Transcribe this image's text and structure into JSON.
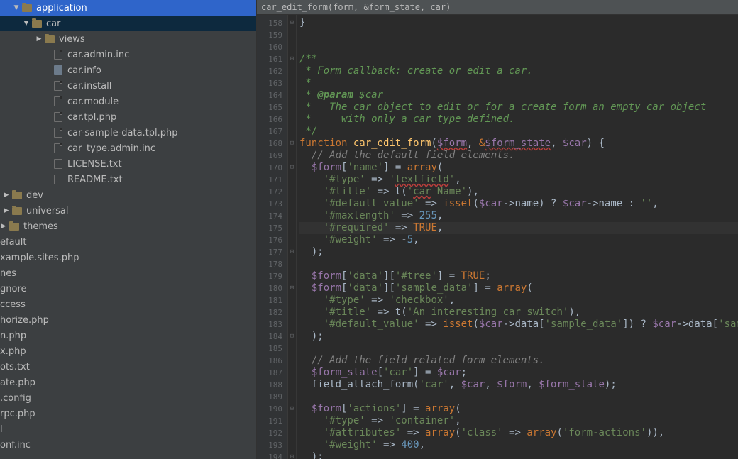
{
  "breadcrumb": "car_edit_form(form, &form_state, car)",
  "sidebar": {
    "items": [
      {
        "label": "application",
        "indent": 18,
        "arrow": "▼",
        "icon": "folder",
        "topsel": true
      },
      {
        "label": "car",
        "indent": 32,
        "arrow": "▼",
        "icon": "folder",
        "sel": true
      },
      {
        "label": "views",
        "indent": 50,
        "arrow": "▶",
        "icon": "folder"
      },
      {
        "label": "car.admin.inc",
        "indent": 62,
        "icon": "php"
      },
      {
        "label": "car.info",
        "indent": 62,
        "icon": "info"
      },
      {
        "label": "car.install",
        "indent": 62,
        "icon": "php"
      },
      {
        "label": "car.module",
        "indent": 62,
        "icon": "php"
      },
      {
        "label": "car.tpl.php",
        "indent": 62,
        "icon": "php"
      },
      {
        "label": "car-sample-data.tpl.php",
        "indent": 62,
        "icon": "php"
      },
      {
        "label": "car_type.admin.inc",
        "indent": 62,
        "icon": "php"
      },
      {
        "label": "LICENSE.txt",
        "indent": 62,
        "icon": "txt"
      },
      {
        "label": "README.txt",
        "indent": 62,
        "icon": "txt"
      },
      {
        "label": "dev",
        "indent": 4,
        "arrow": "▶",
        "icon": "folder"
      },
      {
        "label": "universal",
        "indent": 4,
        "arrow": "▶",
        "icon": "folder"
      },
      {
        "label": "themes",
        "indent": 0,
        "arrow": "▶",
        "icon": "folder"
      },
      {
        "label": "efault",
        "indent": 0,
        "icon": ""
      },
      {
        "label": "xample.sites.php",
        "indent": 0,
        "icon": ""
      },
      {
        "label": "nes",
        "indent": 0,
        "icon": ""
      },
      {
        "label": "gnore",
        "indent": 0,
        "icon": ""
      },
      {
        "label": "ccess",
        "indent": 0,
        "icon": ""
      },
      {
        "label": "horize.php",
        "indent": 0,
        "icon": ""
      },
      {
        "label": "n.php",
        "indent": 0,
        "icon": ""
      },
      {
        "label": "x.php",
        "indent": 0,
        "icon": ""
      },
      {
        "label": "ots.txt",
        "indent": 0,
        "icon": ""
      },
      {
        "label": "ate.php",
        "indent": 0,
        "icon": ""
      },
      {
        "label": ".config",
        "indent": 0,
        "icon": ""
      },
      {
        "label": "rpc.php",
        "indent": 0,
        "icon": ""
      },
      {
        "label": "l",
        "indent": 0,
        "icon": ""
      },
      {
        "label": "onf.inc",
        "indent": 0,
        "icon": ""
      }
    ]
  },
  "gutter": {
    "start": 158,
    "end": 194,
    "highlight": 175
  },
  "fold": {
    "158": "⊟",
    "161": "⊟",
    "168": "⊟",
    "170": "⊟",
    "177": "⊟",
    "180": "⊟",
    "184": "⊟",
    "190": "⊟",
    "194": "⊟"
  },
  "code": {
    "158": {
      "html": "}"
    },
    "159": {
      "html": ""
    },
    "160": {
      "html": ""
    },
    "161": {
      "html": "<span class='doc'>/**</span>"
    },
    "162": {
      "html": "<span class='doc'> * Form callback: create or edit a car.</span>"
    },
    "163": {
      "html": "<span class='doc'> *</span>"
    },
    "164": {
      "html": "<span class='doc'> * <span class='doctag'>@param</span> $car</span>"
    },
    "165": {
      "html": "<span class='doc'> *   The car object to edit or for a create form an empty car object</span>"
    },
    "166": {
      "html": "<span class='doc'> *     with only a car type defined.</span>"
    },
    "167": {
      "html": "<span class='doc'> */</span>"
    },
    "168": {
      "html": "<span class='kw'>function</span> <span class='fn'>car_edit_form</span>(<span class='var err'>$form</span>, <span class='kw'>&</span><span class='var err'>$form_state</span>, <span class='var'>$car</span>) {"
    },
    "169": {
      "html": "  <span class='com'>// Add the default field elements.</span>"
    },
    "170": {
      "html": "  <span class='var'>$form</span>[<span class='str'>'name'</span>] = <span class='kw'>array</span>("
    },
    "171": {
      "html": "    <span class='str'>'#type'</span> =&gt; <span class='str'>'<span class='err'>textfield</span>'</span>,"
    },
    "172": {
      "html": "    <span class='str'>'#title'</span> =&gt; t(<span class='str'>'<span class='err'>car</span> Name'</span>),"
    },
    "173": {
      "html": "    <span class='str'>'#default_value'</span> =&gt; <span class='kw'>isset</span>(<span class='var'>$car</span>-&gt;name) ? <span class='var'>$car</span>-&gt;name : <span class='str'>''</span>,"
    },
    "174": {
      "html": "    <span class='str'>'#maxlength'</span> =&gt; <span class='num'>255</span>,"
    },
    "175": {
      "html": "    <span class='str'>'#required'</span> =&gt; <span class='bool'>TRUE</span>,",
      "hl": true
    },
    "176": {
      "html": "    <span class='str'>'#weight'</span> =&gt; -<span class='num'>5</span>,"
    },
    "177": {
      "html": "  );"
    },
    "178": {
      "html": ""
    },
    "179": {
      "html": "  <span class='var'>$form</span>[<span class='str'>'data'</span>][<span class='str'>'#tree'</span>] = <span class='bool'>TRUE</span>;"
    },
    "180": {
      "html": "  <span class='var'>$form</span>[<span class='str'>'data'</span>][<span class='str'>'sample_data'</span>] = <span class='kw'>array</span>("
    },
    "181": {
      "html": "    <span class='str'>'#type'</span> =&gt; <span class='str'>'checkbox'</span>,"
    },
    "182": {
      "html": "    <span class='str'>'#title'</span> =&gt; t(<span class='str'>'An interesting car switch'</span>),"
    },
    "183": {
      "html": "    <span class='str'>'#default_value'</span> =&gt; <span class='kw'>isset</span>(<span class='var'>$car</span>-&gt;data[<span class='str'>'sample_data'</span>]) ? <span class='var'>$car</span>-&gt;data[<span class='str'>'sample</span>"
    },
    "184": {
      "html": "  );"
    },
    "185": {
      "html": ""
    },
    "186": {
      "html": "  <span class='com'>// Add the field related form elements.</span>"
    },
    "187": {
      "html": "  <span class='var'>$form_state</span>[<span class='str'>'car'</span>] = <span class='var'>$car</span>;"
    },
    "188": {
      "html": "  field_attach_form(<span class='str'>'car'</span>, <span class='var'>$car</span>, <span class='var'>$form</span>, <span class='var'>$form_state</span>);"
    },
    "189": {
      "html": ""
    },
    "190": {
      "html": "  <span class='var'>$form</span>[<span class='str'>'actions'</span>] = <span class='kw'>array</span>("
    },
    "191": {
      "html": "    <span class='str'>'#type'</span> =&gt; <span class='str'>'container'</span>,"
    },
    "192": {
      "html": "    <span class='str'>'#attributes'</span> =&gt; <span class='kw'>array</span>(<span class='str'>'class'</span> =&gt; <span class='kw'>array</span>(<span class='str'>'form-actions'</span>)),"
    },
    "193": {
      "html": "    <span class='str'>'#weight'</span> =&gt; <span class='num'>400</span>,"
    },
    "194": {
      "html": "  );"
    }
  }
}
